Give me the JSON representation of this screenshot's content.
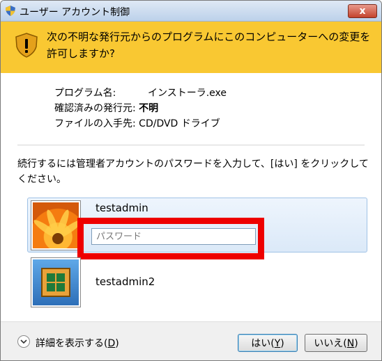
{
  "window": {
    "title": "ユーザー アカウント制御",
    "close_label": "x"
  },
  "banner": {
    "message": "次の不明な発行元からのプログラムにこのコンピューターへの変更を許可しますか?"
  },
  "details": {
    "program_label": "プログラム名:",
    "program_value": "インストーラ.exe",
    "publisher_label": "確認済みの発行元:",
    "publisher_value": "不明",
    "source_label": "ファイルの入手先:",
    "source_value": "CD/DVD ドライブ"
  },
  "instruction": "続行するには管理者アカウントのパスワードを入力して、[はい] をクリックしてください。",
  "accounts": [
    {
      "name": "testadmin",
      "password_placeholder": "パスワード"
    },
    {
      "name": "testadmin2"
    }
  ],
  "footer": {
    "show_details_label": "詳細を表示する(",
    "show_details_key": "D",
    "show_details_end": ")",
    "yes_label": "はい(",
    "yes_key": "Y",
    "no_label": "いいえ(",
    "no_key": "N",
    "close_paren": ")"
  },
  "colors": {
    "banner": "#f9c832",
    "highlight": "#ee0000",
    "selected_account": "#dbe9f8"
  },
  "icons": {
    "title": "uac-shield-icon",
    "banner": "warning-shield-icon",
    "details_toggle": "chevron-down-icon",
    "account1_avatar": "flower-avatar-icon",
    "account2_avatar": "chess-board-avatar-icon"
  }
}
